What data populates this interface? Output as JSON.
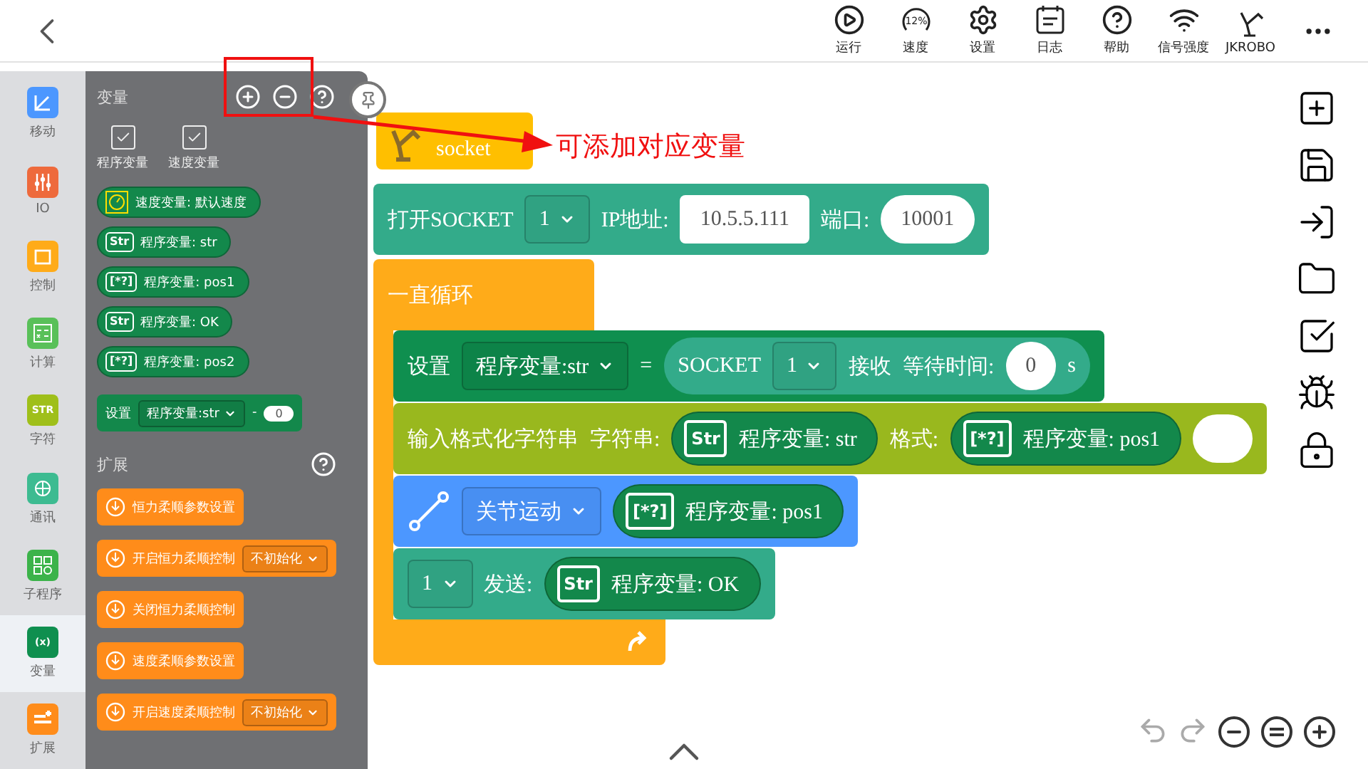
{
  "topbar": {
    "tools": [
      {
        "kind": "run",
        "label": "运行"
      },
      {
        "kind": "speed",
        "label": "速度",
        "badge": "12%"
      },
      {
        "kind": "settings",
        "label": "设置"
      },
      {
        "kind": "log",
        "label": "日志"
      },
      {
        "kind": "help",
        "label": "帮助"
      },
      {
        "kind": "signal",
        "label": "信号强度"
      },
      {
        "kind": "robot",
        "label": "JKROBO"
      },
      {
        "kind": "more"
      }
    ]
  },
  "categories": [
    {
      "label": "移动",
      "kind": "move",
      "color": "#4c97ff",
      "selected": false
    },
    {
      "label": "IO",
      "kind": "io",
      "color": "#ee6a3c",
      "selected": false
    },
    {
      "label": "控制",
      "kind": "control",
      "color": "#ffab19",
      "selected": false
    },
    {
      "label": "计算",
      "kind": "calc",
      "color": "#59c059",
      "selected": false
    },
    {
      "label": "字符",
      "kind": "glyph",
      "glyph": "STR",
      "color": "#9fbf1a",
      "selected": false
    },
    {
      "label": "通讯",
      "kind": "comm",
      "color": "#3dbb91",
      "selected": false
    },
    {
      "label": "子程序",
      "kind": "sub",
      "color": "#3cb34a",
      "selected": false
    },
    {
      "label": "变量",
      "kind": "glyph",
      "glyph": "(x)",
      "color": "#0f8f4f",
      "selected": true
    },
    {
      "label": "扩展",
      "kind": "ext",
      "color": "#ff8c1a",
      "selected": false
    }
  ],
  "flyout": {
    "title": "变量",
    "checkboxes": [
      {
        "label": "程序变量",
        "checked": true
      },
      {
        "label": "速度变量",
        "checked": true
      }
    ],
    "variables": [
      {
        "kind": "speed",
        "label": "速度变量: 默认速度"
      },
      {
        "kind": "glyph",
        "glyph": "Str",
        "label": "程序变量: str"
      },
      {
        "kind": "glyph",
        "glyph": "[*?]",
        "label": "程序变量: pos1"
      },
      {
        "kind": "glyph",
        "glyph": "Str",
        "label": "程序变量: OK"
      },
      {
        "kind": "glyph",
        "glyph": "[*?]",
        "label": "程序变量: pos2"
      }
    ],
    "set_block": {
      "label": "设置",
      "variable": "程序变量:str",
      "op": "-",
      "value": "0"
    },
    "extension": {
      "title": "扩展",
      "blocks": [
        {
          "label": "恒力柔顺参数设置"
        },
        {
          "label": "开启恒力柔顺控制",
          "dropdown": "不初始化"
        },
        {
          "label": "关闭恒力柔顺控制"
        },
        {
          "label": "速度柔顺参数设置"
        },
        {
          "label": "开启速度柔顺控制",
          "dropdown": "不初始化"
        }
      ]
    }
  },
  "canvas": {
    "hat": {
      "label": "socket"
    },
    "open_socket": {
      "label": "打开SOCKET",
      "socket": "1",
      "ip_label": "IP地址:",
      "ip": "10.5.5.111",
      "port_label": "端口:",
      "port": "10001"
    },
    "loop": {
      "label": "一直循环",
      "blocks": [
        {
          "kind": "set",
          "label": "设置",
          "variable": "程序变量:str",
          "op": "=",
          "source": "SOCKET",
          "socket": "1",
          "action": "接收",
          "wait_label": "等待时间:",
          "wait": "0",
          "unit": "s"
        },
        {
          "kind": "format",
          "label": "输入格式化字符串",
          "string_label": "字符串:",
          "string_var": {
            "glyph": "Str",
            "label": "程序变量: str"
          },
          "format_label": "格式:",
          "format_var": {
            "glyph": "[*?]",
            "label": "程序变量: pos1"
          }
        },
        {
          "kind": "joint",
          "mode": "关节运动",
          "target": {
            "glyph": "[*?]",
            "label": "程序变量: pos1"
          }
        },
        {
          "kind": "send",
          "socket": "1",
          "label": "发送:",
          "value": {
            "glyph": "Str",
            "label": "程序变量: OK"
          }
        }
      ]
    }
  },
  "annotation": {
    "text": "可添加对应变量"
  }
}
